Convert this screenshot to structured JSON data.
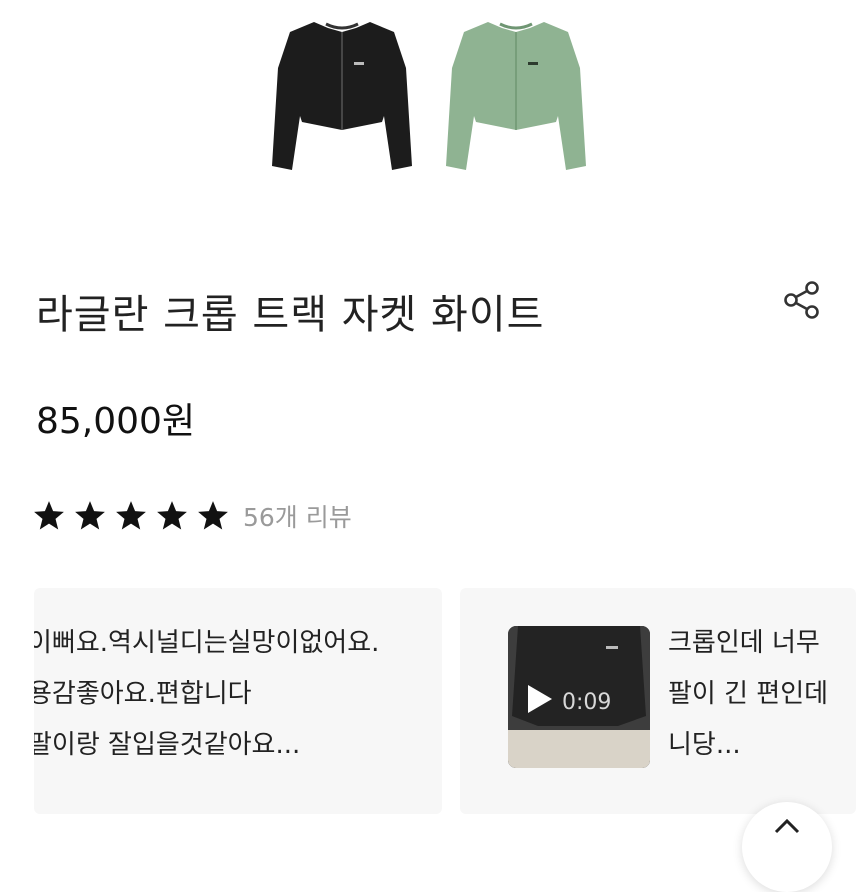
{
  "product": {
    "title": "라글란 크롭 트랙 자켓 화이트",
    "price": "85,000원",
    "rating": 5,
    "max_rating": 5,
    "review_count_label": "56개 리뷰",
    "variant_colors": [
      "#1c1c1c",
      "#8fb392"
    ]
  },
  "reviews": [
    {
      "lines": [
        "이뻐요.역시널디는실망이없어요.",
        "용감좋아요.편합니다",
        "팔이랑 잘입을것같아요..."
      ]
    },
    {
      "video_duration": "0:09",
      "lines": [
        "크롭인데 너무",
        "팔이 긴 편인데",
        "니당..."
      ]
    }
  ],
  "icons": {
    "share": "share-icon",
    "scroll_top": "chevron-up-icon",
    "play": "play-icon",
    "star": "star-icon"
  }
}
